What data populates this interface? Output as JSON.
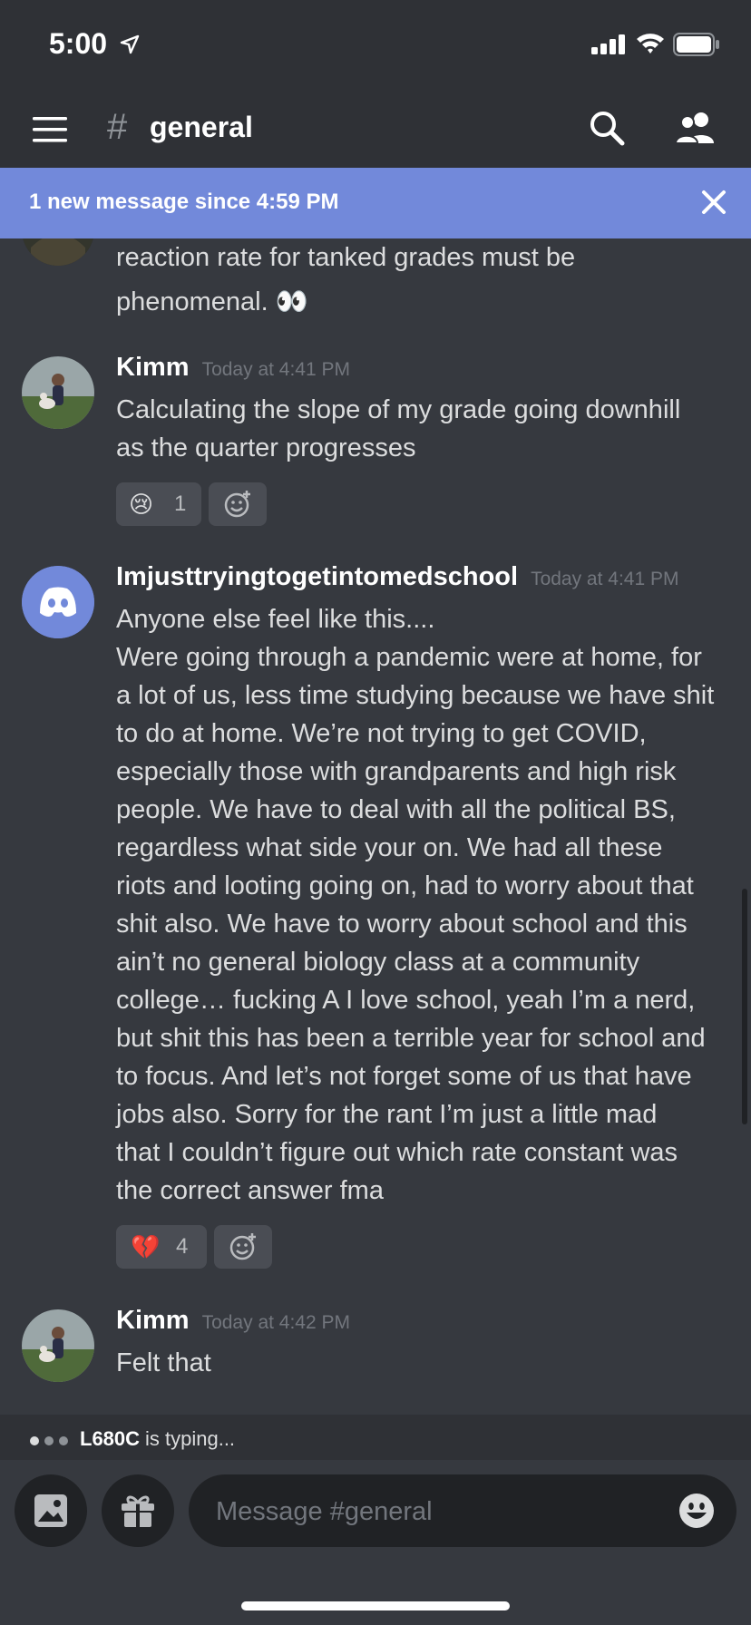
{
  "status_bar": {
    "time": "5:00"
  },
  "header": {
    "channel": "general"
  },
  "banner": {
    "text": "1 new message since 4:59 PM"
  },
  "messages": [
    {
      "continued": true,
      "lines": [
        "reaction rate for tanked grades must be",
        "phenomenal. 👀"
      ]
    },
    {
      "author": "Kimm",
      "timestamp": "Today at 4:41 PM",
      "lines": [
        "Calculating the slope of my grade going downhill",
        "as the quarter progresses"
      ],
      "reactions": [
        {
          "emoji": "😢",
          "count": "1"
        }
      ]
    },
    {
      "author": "Imjusttryingtogetintomedschool",
      "timestamp": "Today at 4:41 PM",
      "lines": [
        "Anyone else feel like this....",
        "Were going through a pandemic were at home, for",
        "a lot of us, less time studying because we have shit",
        "to do at home. We’re not trying to get COVID,",
        "especially those with grandparents and high risk",
        "people. We have to deal with all the political BS,",
        "regardless what side your on. We had all these",
        "riots and looting going on, had to worry about that",
        "shit also. We have to worry about school and this",
        "ain’t no general biology class at a community",
        "college… fucking A I love school, yeah I’m a nerd,",
        "but shit this has been a terrible year for school and",
        "to focus. And let’s not forget some of us that have",
        "jobs also. Sorry for the rant I’m just a little mad",
        "that I couldn’t figure out which rate constant was",
        "the correct answer fma"
      ],
      "reactions": [
        {
          "emoji": "💔",
          "count": "4"
        }
      ]
    },
    {
      "author": "Kimm",
      "timestamp": "Today at 4:42 PM",
      "lines": [
        "Felt that"
      ]
    }
  ],
  "typing": {
    "user": "L680C",
    "text": "is typing..."
  },
  "composer": {
    "placeholder": "Message #general"
  }
}
